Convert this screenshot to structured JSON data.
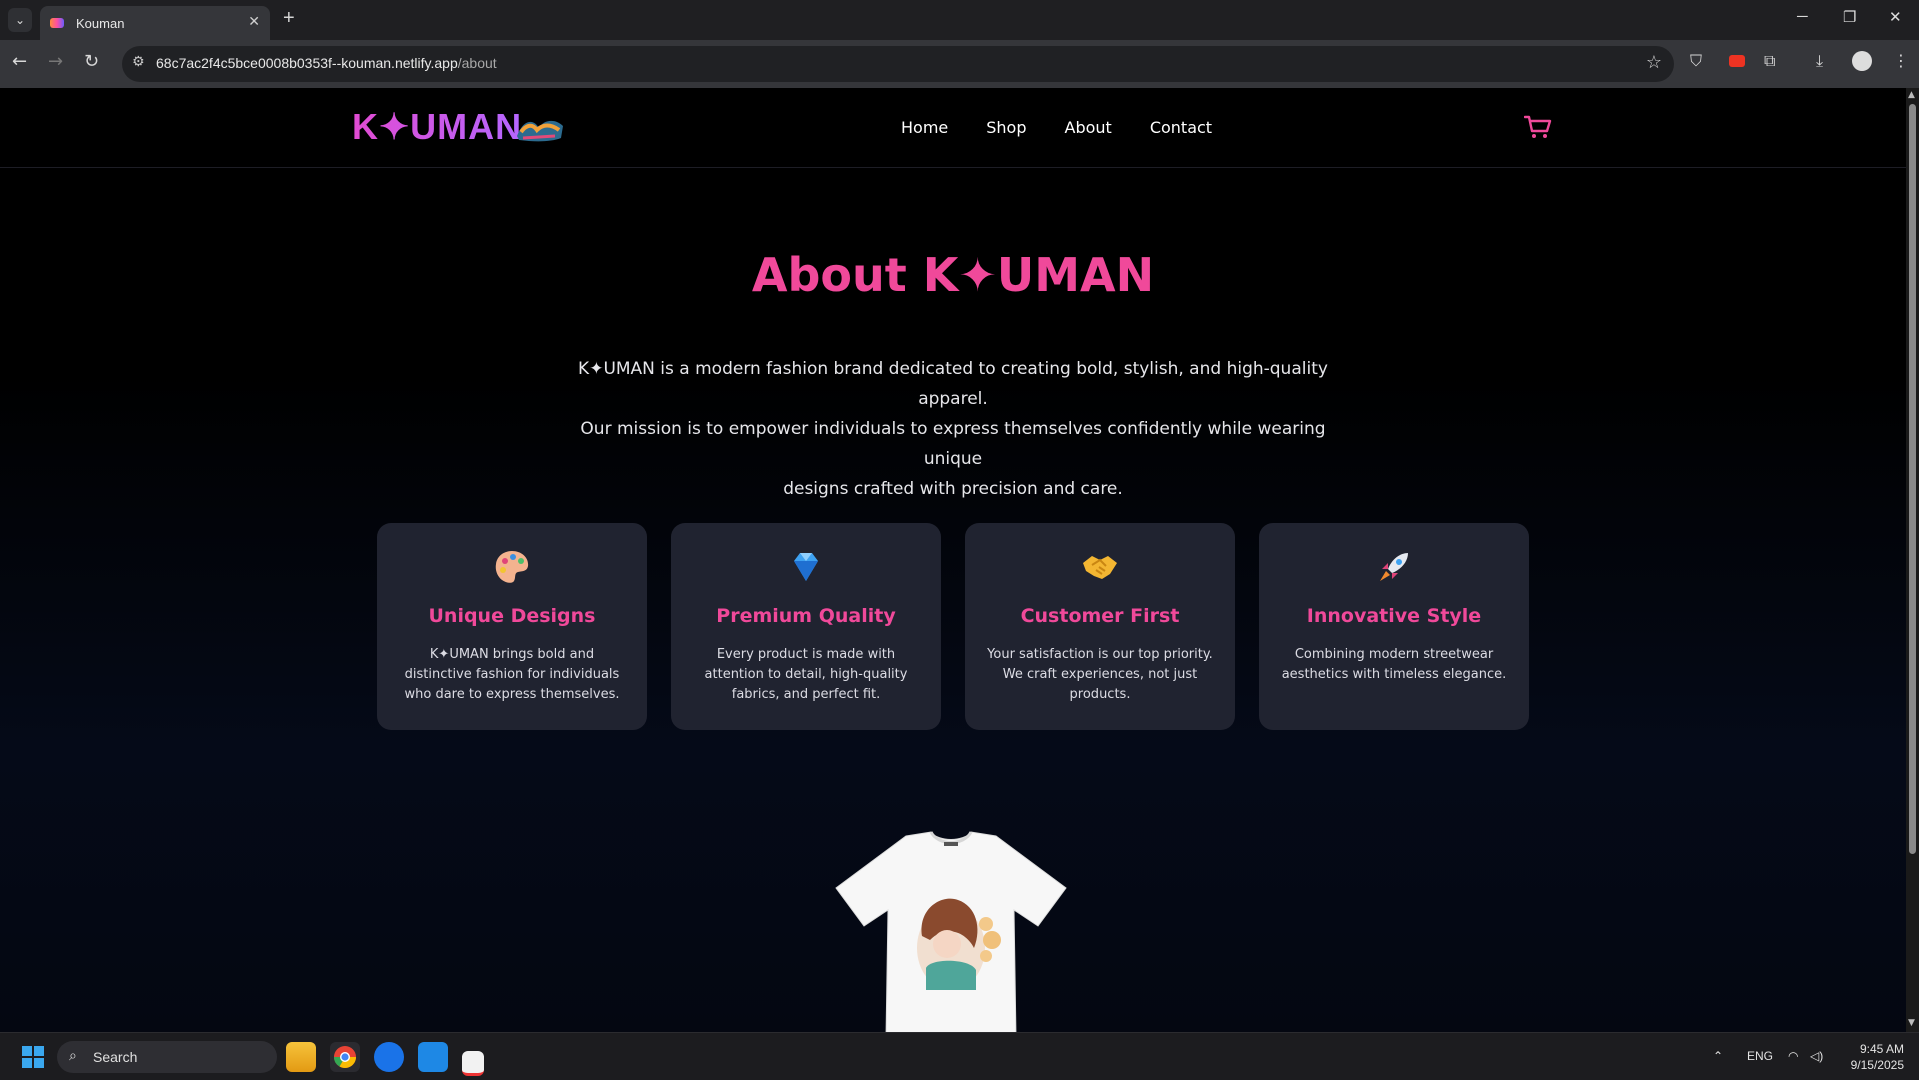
{
  "browser": {
    "tab_title": "Kouman",
    "url_host": "68c7ac2f4c5bce0008b0353f--kouman.netlify.app",
    "url_path": "/about",
    "new_tab": "+",
    "minimize": "─",
    "restore": "❐",
    "close": "✕"
  },
  "site": {
    "logo_text": "K✦UMAN",
    "nav": [
      "Home",
      "Shop",
      "About",
      "Contact"
    ]
  },
  "about": {
    "title": "About K✦UMAN",
    "lines": [
      "K✦UMAN is a modern fashion brand dedicated to creating bold, stylish, and high-quality apparel.",
      "Our mission is to empower individuals to express themselves confidently while wearing unique",
      "designs crafted with precision and care."
    ]
  },
  "features": [
    {
      "icon": "palette-icon",
      "title": "Unique Designs",
      "text": "K✦UMAN brings bold and distinctive fashion for individuals who dare to express themselves."
    },
    {
      "icon": "gem-icon",
      "title": "Premium Quality",
      "text": "Every product is made with attention to detail, high-quality fabrics, and perfect fit."
    },
    {
      "icon": "handshake-icon",
      "title": "Customer First",
      "text": "Your satisfaction is our top priority. We craft experiences, not just products."
    },
    {
      "icon": "rocket-icon",
      "title": "Innovative Style",
      "text": "Combining modern streetwear aesthetics with timeless elegance."
    }
  ],
  "taskbar": {
    "search_placeholder": "Search",
    "lang": "ENG",
    "time": "9:45 AM",
    "date": "9/15/2025"
  },
  "colors": {
    "accent": "#f0499a",
    "card_bg": "#202330"
  }
}
